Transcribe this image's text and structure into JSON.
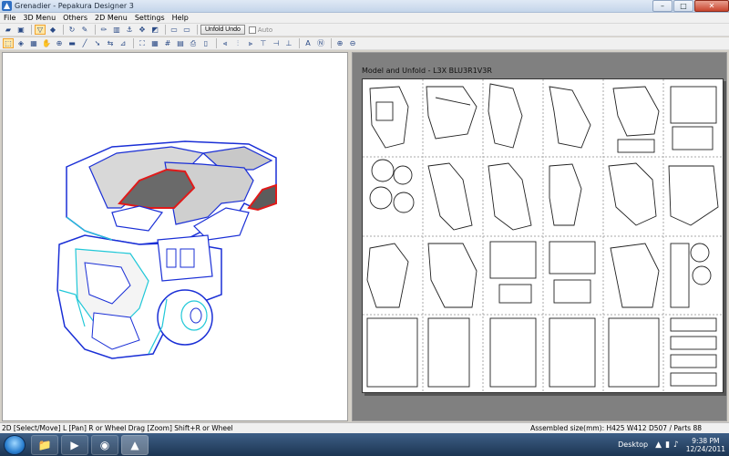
{
  "window": {
    "title": "Grenadier - Pepakura Designer 3",
    "minimize": "–",
    "maximize": "□",
    "close": "✕"
  },
  "menu": [
    "File",
    "3D Menu",
    "Others",
    "2D Menu",
    "Settings",
    "Help"
  ],
  "toolbar": {
    "unfold_undo": "Unfold Undo",
    "auto_label": "Auto",
    "auto_checked": false
  },
  "view2d": {
    "sheet_title": "Model and Unfold - L3X BLU3R1V3R"
  },
  "status": {
    "left": "2D [Select/Move] L [Pan] R or Wheel Drag [Zoom] Shift+R or Wheel",
    "right": "Assembled size(mm): H425 W412 D507 / Parts 88"
  },
  "taskbar": {
    "desktop_label": "Desktop",
    "time": "9:38 PM",
    "date": "12/24/2011"
  },
  "colors": {
    "edge_blue": "#1a2fd6",
    "edge_red": "#e01a1a",
    "edge_cyan": "#22c8d8",
    "highlight": "#f0a330"
  }
}
